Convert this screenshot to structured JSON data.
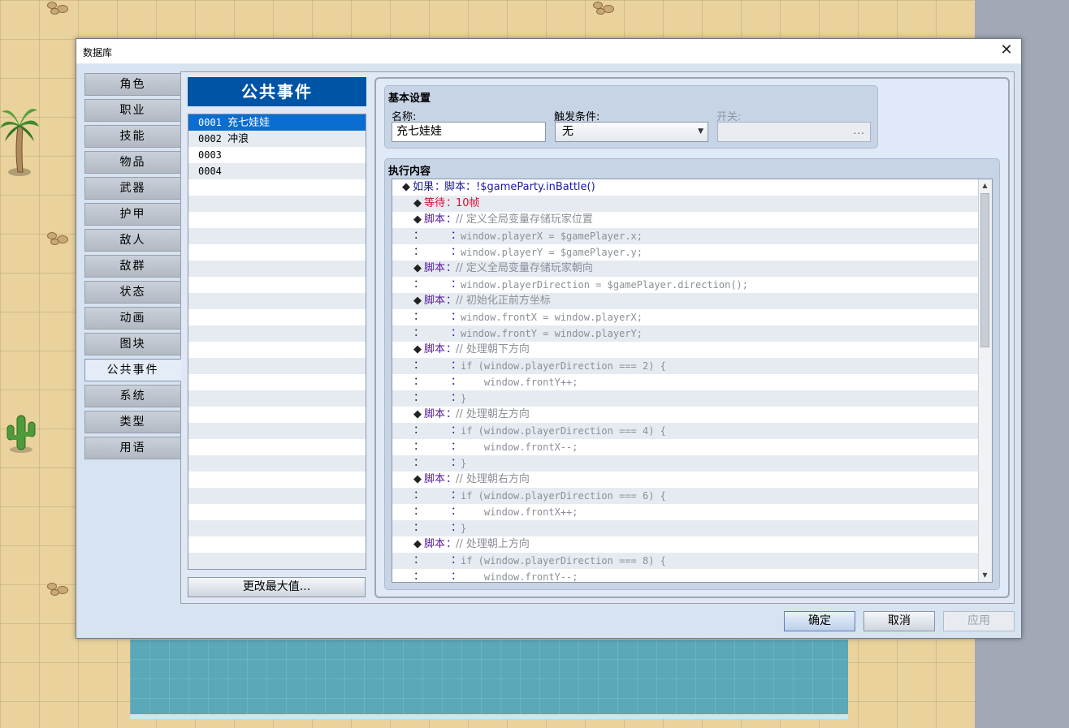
{
  "window": {
    "title": "数据库",
    "close_icon": "close-icon"
  },
  "nav": {
    "items": [
      "角色",
      "职业",
      "技能",
      "物品",
      "武器",
      "护甲",
      "敌人",
      "敌群",
      "状态",
      "动画",
      "图块",
      "公共事件",
      "系统",
      "类型",
      "用语"
    ],
    "active_index": 11
  },
  "event_list": {
    "header": "公共事件",
    "items": [
      {
        "id": "0001",
        "name": "充七娃娃",
        "selected": true
      },
      {
        "id": "0002",
        "name": "冲浪",
        "selected": false
      },
      {
        "id": "0003",
        "name": "",
        "selected": false
      },
      {
        "id": "0004",
        "name": "",
        "selected": false
      }
    ],
    "change_max_button": "更改最大值..."
  },
  "basic_settings": {
    "title": "基本设置",
    "name_label": "名称:",
    "name_value": "充七娃娃",
    "trigger_label": "触发条件:",
    "trigger_value": "无",
    "switch_label": "开关:",
    "switch_dots": "..."
  },
  "execution": {
    "title": "执行内容",
    "lines": [
      {
        "indent": 0,
        "marker": "◆",
        "cmd": "如果",
        "sep": "：",
        "text": "脚本：!$gameParty.inBattle()",
        "kind": "if"
      },
      {
        "indent": 1,
        "marker": "◆",
        "cmd": "等待",
        "sep": "：",
        "text": "10帧",
        "kind": "wait"
      },
      {
        "indent": 1,
        "marker": "◆",
        "cmd": "脚本",
        "sep": "：",
        "text": "// 定义全局变量存储玩家位置",
        "kind": "script"
      },
      {
        "indent": 1,
        "marker": "：",
        "cmd": "",
        "sep": "：",
        "text": "window.playerX = $gamePlayer.x;",
        "kind": "cont"
      },
      {
        "indent": 1,
        "marker": "：",
        "cmd": "",
        "sep": "：",
        "text": "window.playerY = $gamePlayer.y;",
        "kind": "cont"
      },
      {
        "indent": 1,
        "marker": "◆",
        "cmd": "脚本",
        "sep": "：",
        "text": "// 定义全局变量存储玩家朝向",
        "kind": "script"
      },
      {
        "indent": 1,
        "marker": "：",
        "cmd": "",
        "sep": "：",
        "text": "window.playerDirection = $gamePlayer.direction();",
        "kind": "cont"
      },
      {
        "indent": 1,
        "marker": "◆",
        "cmd": "脚本",
        "sep": "：",
        "text": "// 初始化正前方坐标",
        "kind": "script"
      },
      {
        "indent": 1,
        "marker": "：",
        "cmd": "",
        "sep": "：",
        "text": "window.frontX = window.playerX;",
        "kind": "cont"
      },
      {
        "indent": 1,
        "marker": "：",
        "cmd": "",
        "sep": "：",
        "text": "window.frontY = window.playerY;",
        "kind": "cont"
      },
      {
        "indent": 1,
        "marker": "◆",
        "cmd": "脚本",
        "sep": "：",
        "text": "// 处理朝下方向",
        "kind": "script"
      },
      {
        "indent": 1,
        "marker": "：",
        "cmd": "",
        "sep": "：",
        "text": "if (window.playerDirection === 2) {",
        "kind": "cont"
      },
      {
        "indent": 1,
        "marker": "：",
        "cmd": "",
        "sep": "：",
        "text": "    window.frontY++;",
        "kind": "cont"
      },
      {
        "indent": 1,
        "marker": "：",
        "cmd": "",
        "sep": "：",
        "text": "}",
        "kind": "cont"
      },
      {
        "indent": 1,
        "marker": "◆",
        "cmd": "脚本",
        "sep": "：",
        "text": "// 处理朝左方向",
        "kind": "script"
      },
      {
        "indent": 1,
        "marker": "：",
        "cmd": "",
        "sep": "：",
        "text": "if (window.playerDirection === 4) {",
        "kind": "cont"
      },
      {
        "indent": 1,
        "marker": "：",
        "cmd": "",
        "sep": "：",
        "text": "    window.frontX--;",
        "kind": "cont"
      },
      {
        "indent": 1,
        "marker": "：",
        "cmd": "",
        "sep": "：",
        "text": "}",
        "kind": "cont"
      },
      {
        "indent": 1,
        "marker": "◆",
        "cmd": "脚本",
        "sep": "：",
        "text": "// 处理朝右方向",
        "kind": "script"
      },
      {
        "indent": 1,
        "marker": "：",
        "cmd": "",
        "sep": "：",
        "text": "if (window.playerDirection === 6) {",
        "kind": "cont"
      },
      {
        "indent": 1,
        "marker": "：",
        "cmd": "",
        "sep": "：",
        "text": "    window.frontX++;",
        "kind": "cont"
      },
      {
        "indent": 1,
        "marker": "：",
        "cmd": "",
        "sep": "：",
        "text": "}",
        "kind": "cont"
      },
      {
        "indent": 1,
        "marker": "◆",
        "cmd": "脚本",
        "sep": "：",
        "text": "// 处理朝上方向",
        "kind": "script"
      },
      {
        "indent": 1,
        "marker": "：",
        "cmd": "",
        "sep": "：",
        "text": "if (window.playerDirection === 8) {",
        "kind": "cont"
      },
      {
        "indent": 1,
        "marker": "：",
        "cmd": "",
        "sep": "：",
        "text": "    window.frontY--;",
        "kind": "cont"
      }
    ]
  },
  "buttons": {
    "ok": "确定",
    "cancel": "取消",
    "apply": "应用"
  },
  "colors": {
    "selection": "#0a6ed1",
    "list_header": "#0054a6",
    "if_blue": "#1a1aa6",
    "script_purple": "#5a1a9a",
    "wait_red": "#d01030",
    "comment_grey": "#8a8f99"
  }
}
